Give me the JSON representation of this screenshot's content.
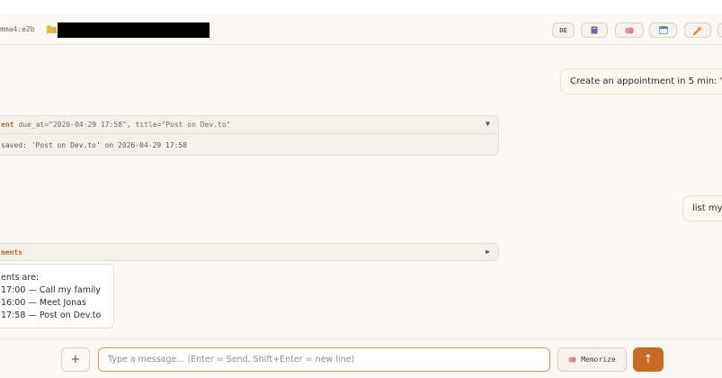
{
  "header": {
    "model": "mma4:e2b",
    "lang": "DE"
  },
  "messages": {
    "user1": "Create an appointment in 5 min: \"P",
    "user2": "list my"
  },
  "tool1": {
    "name": "ent",
    "args": "due_at=\"2026-04-29 17:58\", title=\"Post on Dev.to\"",
    "result": "saved: 'Post on Dev.to' on 2026-04-29 17:58",
    "toggle": "▼"
  },
  "tool2": {
    "name": "ments",
    "toggle": "▶"
  },
  "assistant": {
    "lines": [
      "ents are:",
      "17:00 — Call my family",
      "16:00 — Meet Jonas",
      "17:58 — Post on Dev.to"
    ]
  },
  "footer": {
    "plus_label": "+",
    "input_placeholder": "Type a message... (Enter = Send, Shift+Enter = new line)",
    "input_value": "",
    "memorize_label": "Memorize",
    "send_label": "↑"
  },
  "icons": {
    "folder": "folder-icon",
    "book": "book-icon",
    "brain": "brain-icon",
    "calendar": "calendar-icon",
    "tools": "tools-icon"
  },
  "colors": {
    "accent": "#c96a25",
    "tool_name": "#b06a2a"
  }
}
